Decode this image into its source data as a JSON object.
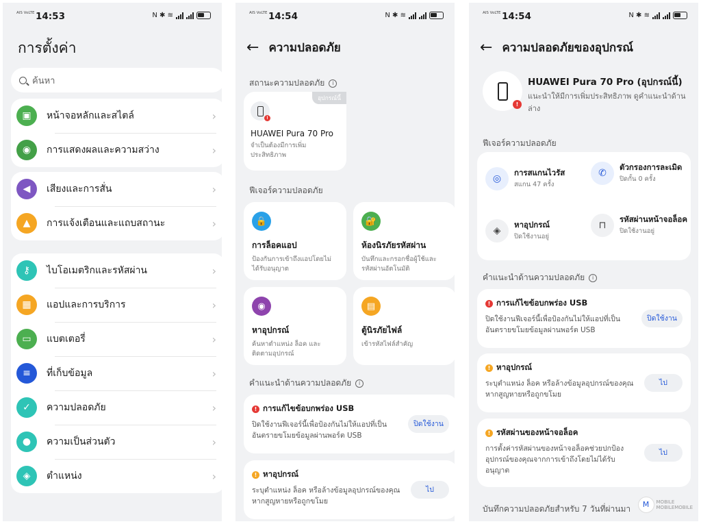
{
  "status_bar": {
    "sim": "AIS VoLTE",
    "time": "14:53",
    "time2": "14:54",
    "time3": "14:54",
    "icons": "N ✱ ≋"
  },
  "screen1": {
    "title": "การตั้งค่า",
    "search_placeholder": "ค้นหา",
    "groups": [
      [
        {
          "label": "หน้าจอหลักและสไตล์",
          "icon": "wallpaper-icon",
          "color": "#4caf50",
          "glyph": "▣"
        },
        {
          "label": "การแสดงผลและความสว่าง",
          "icon": "eye-icon",
          "color": "#43a047",
          "glyph": "◉"
        }
      ],
      [
        {
          "label": "เสียงและการสั่น",
          "icon": "speaker-icon",
          "color": "#7e57c2",
          "glyph": "◀"
        },
        {
          "label": "การแจ้งเตือนและแถบสถานะ",
          "icon": "bell-icon",
          "color": "#f5a623",
          "glyph": "▲"
        }
      ],
      [
        {
          "label": "ไบโอเมตริกและรหัสผ่าน",
          "icon": "key-icon",
          "color": "#2ec4b6",
          "glyph": "⚷"
        },
        {
          "label": "แอปและการบริการ",
          "icon": "apps-icon",
          "color": "#f5a623",
          "glyph": "▦"
        },
        {
          "label": "แบตเตอรี่",
          "icon": "battery-icon",
          "color": "#4caf50",
          "glyph": "▭"
        },
        {
          "label": "ที่เก็บข้อมูล",
          "icon": "storage-icon",
          "color": "#2458d8",
          "glyph": "≡"
        },
        {
          "label": "ความปลอดภัย",
          "icon": "shield-icon",
          "color": "#2ec4b6",
          "glyph": "✓"
        },
        {
          "label": "ความเป็นส่วนตัว",
          "icon": "privacy-icon",
          "color": "#2ec4b6",
          "glyph": "●"
        },
        {
          "label": "ตำแหน่ง",
          "icon": "location-icon",
          "color": "#2ec4b6",
          "glyph": "◈"
        }
      ]
    ]
  },
  "screen2": {
    "title": "ความปลอดภัย",
    "status_section": "สถานะความปลอดภัย",
    "device_badge": "อุปกรณ์นี้",
    "device_name": "HUAWEI Pura 70 Pro",
    "device_desc": "จำเป็นต้องมีการเพิ่มประสิทธิภาพ",
    "features_section": "ฟีเจอร์ความปลอดภัย",
    "tiles": [
      {
        "title": "การล็อคแอป",
        "desc": "ป้องกันการเข้าถึงแอปโดยไม่ได้รับอนุญาต",
        "icon": "lock-icon",
        "color": "#2aa1e8",
        "glyph": "🔒"
      },
      {
        "title": "ห้องนิรภัยรหัสผ่าน",
        "desc": "บันทึกและกรอกชื่อผู้ใช้และรหัสผ่านอัตโนมัติ",
        "icon": "vault-icon",
        "color": "#4caf50",
        "glyph": "🔐"
      },
      {
        "title": "หาอุปกรณ์",
        "desc": "ค้นหาตำแหน่ง ล็อค และติดตามอุปกรณ์",
        "icon": "find-device-icon",
        "color": "#8e44ad",
        "glyph": "◉"
      },
      {
        "title": "ตู้นิรภัยไฟล์",
        "desc": "เข้ารหัสไฟล์สำคัญ",
        "icon": "file-safe-icon",
        "color": "#f5a623",
        "glyph": "▤"
      }
    ],
    "reco_section": "คำแนะนำด้านความปลอดภัย",
    "recos": [
      {
        "title": "การแก้ไขข้อบกพร่อง USB",
        "desc": "ปิดใช้งานฟีเจอร์นี้เพื่อป้องกันไม่ให้แอปที่เป็นอันตรายขโมยข้อมูลผ่านพอร์ต USB",
        "button": "ปิดใช้งาน",
        "level": "red"
      },
      {
        "title": "หาอุปกรณ์",
        "desc": "ระบุตำแหน่ง ล็อค หรือล้างข้อมูลอุปกรณ์ของคุณหากสูญหายหรือถูกขโมย",
        "button": "ไป",
        "level": "amber"
      }
    ]
  },
  "screen3": {
    "title": "ความปลอดภัยของอุปกรณ์",
    "device_name": "HUAWEI Pura 70 Pro (อุปกรณ์นี้)",
    "device_desc": "แนะนำให้มีการเพิ่มประสิทธิภาพ ดูคำแนะนำด้านล่าง",
    "features_section": "ฟีเจอร์ความปลอดภัย",
    "features": [
      {
        "title": "การสแกนไวรัส",
        "sub": "สแกน 47 ครั้ง",
        "icon": "virus-scan-icon",
        "glyph": "◎",
        "style": "blue"
      },
      {
        "title": "ตัวกรองการละเมิด",
        "sub": "ปิดกั้น 0 ครั้ง",
        "icon": "call-filter-icon",
        "glyph": "✆",
        "style": "blue"
      },
      {
        "title": "หาอุปกรณ์",
        "sub": "ปิดใช้งานอยู่",
        "icon": "location-pin-icon",
        "glyph": "◈",
        "style": "grey"
      },
      {
        "title": "รหัสผ่านหน้าจอล็อค",
        "sub": "ปิดใช้งานอยู่",
        "icon": "padlock-icon",
        "glyph": "⊓",
        "style": "grey"
      }
    ],
    "reco_section": "คำแนะนำด้านความปลอดภัย",
    "recos": [
      {
        "title": "การแก้ไขข้อบกพร่อง USB",
        "desc": "ปิดใช้งานฟีเจอร์นี้เพื่อป้องกันไม่ให้แอปที่เป็นอันตรายขโมยข้อมูลผ่านพอร์ต USB",
        "button": "ปิดใช้งาน",
        "level": "red"
      },
      {
        "title": "หาอุปกรณ์",
        "desc": "ระบุตำแหน่ง ล็อค หรือล้างข้อมูลอุปกรณ์ของคุณหากสูญหายหรือถูกขโมย",
        "button": "ไป",
        "level": "amber"
      },
      {
        "title": "รหัสผ่านของหน้าจอล็อค",
        "desc": "การตั้งค่ารหัสผ่านของหน้าจอล็อคช่วยปกป้องอุปกรณ์ของคุณจากการเข้าถึงโดยไม่ได้รับอนุญาต",
        "button": "ไป",
        "level": "amber"
      }
    ],
    "log_section": "บันทึกความปลอดภัยสำหรับ 7 วันที่ผ่านมา"
  },
  "watermark": {
    "logo": "M",
    "text": "MOBILE\nMOBILEMOBILE"
  }
}
